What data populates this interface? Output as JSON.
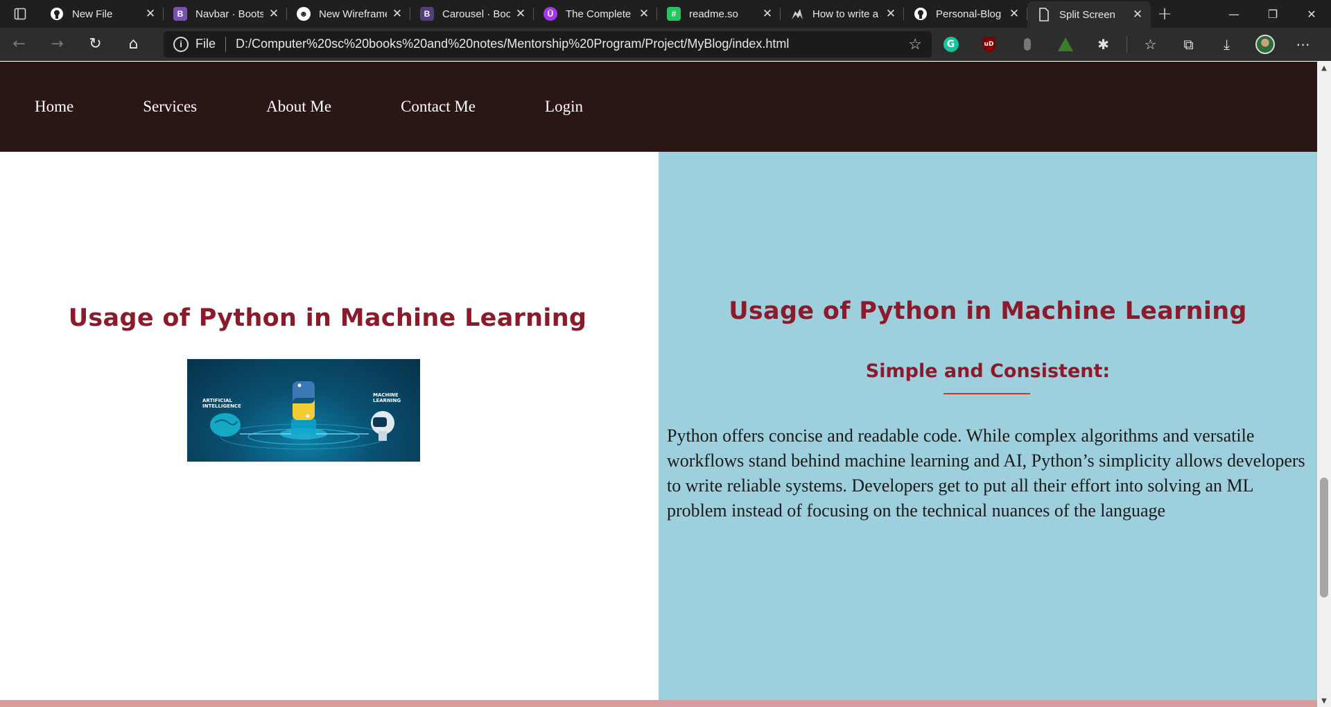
{
  "browser": {
    "tabs": [
      {
        "title": "New File",
        "icon": "github-icon",
        "color": "#ffffff"
      },
      {
        "title": "Navbar · Bootstrap",
        "icon": "bootstrap-icon",
        "color": "#7952b3"
      },
      {
        "title": "New Wireframe",
        "icon": "wireframe-smile-icon",
        "color": "#ffffff"
      },
      {
        "title": "Carousel · Bootstrap",
        "icon": "bootstrap-icon",
        "color": "#563d7c"
      },
      {
        "title": "The Complete",
        "icon": "udemy-icon",
        "color": "#a435f0"
      },
      {
        "title": "readme.so",
        "icon": "readme-icon",
        "color": "#22c55e"
      },
      {
        "title": "How to write a",
        "icon": "bird-icon",
        "color": "#222222"
      },
      {
        "title": "Personal-Blog",
        "icon": "github-icon",
        "color": "#ffffff"
      },
      {
        "title": "Split Screen",
        "icon": "page-icon",
        "color": "#ffffff",
        "active": true
      }
    ],
    "address": {
      "scheme_label": "File",
      "url": "D:/Computer%20sc%20books%20and%20notes/Mentorship%20Program/Project/MyBlog/index.html"
    }
  },
  "site": {
    "nav": [
      "Home",
      "Services",
      "About Me",
      "Contact Me",
      "Login"
    ],
    "left": {
      "heading": "Usage of Python in Machine Learning",
      "image": {
        "label_left": "ARTIFICIAL INTELLIGENCE",
        "label_right": "MACHINE LEARNING"
      }
    },
    "right": {
      "heading": "Usage of Python in Machine Learning",
      "subheading": "Simple and Consistent:",
      "body": "Python offers concise and readable code. While complex algorithms and versatile workflows stand behind machine learning and AI, Python’s simplicity allows developers to write reliable systems. Developers get to put all their effort into solving an ML problem instead of focusing on the technical nuances of the language"
    }
  },
  "colors": {
    "nav_bg": "#2b1616",
    "heading": "#8b1a2b",
    "right_bg": "#9dcfdd",
    "bottom_strip": "#d89c9c"
  }
}
